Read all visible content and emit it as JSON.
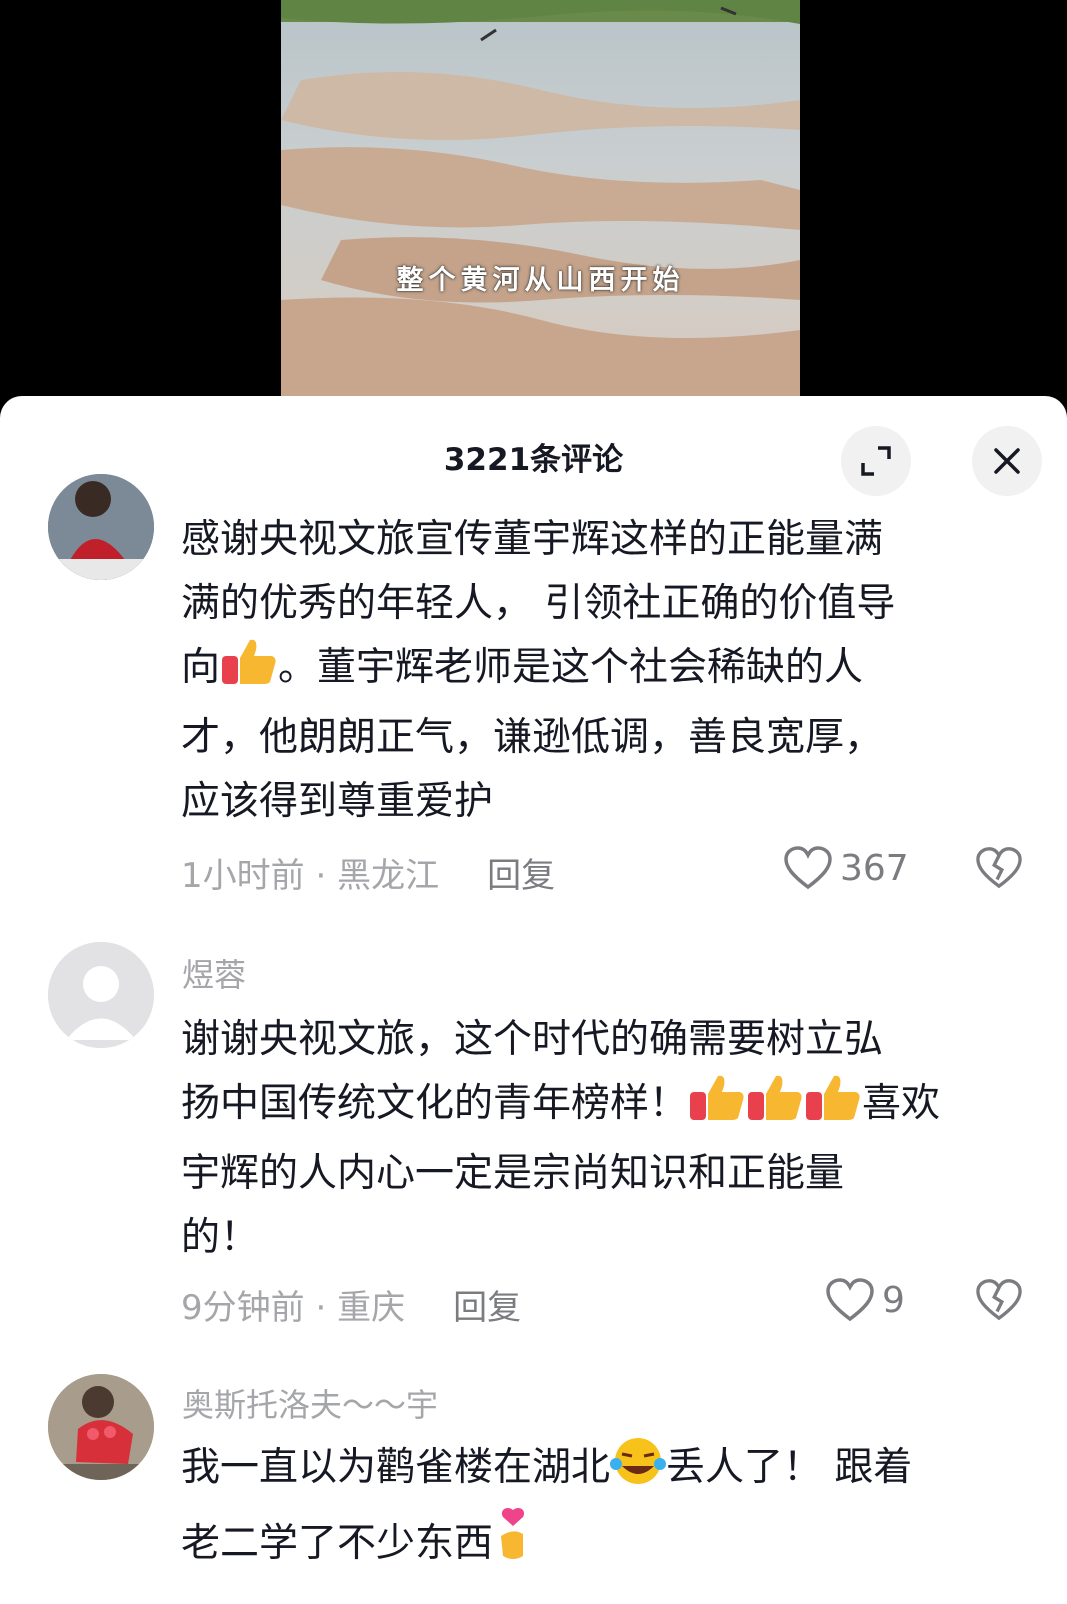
{
  "video": {
    "subtitle": "整个黄河从山西开始"
  },
  "sheet": {
    "title": "3221条评论",
    "expand_icon": "expand-icon",
    "close_icon": "close-icon"
  },
  "comments": [
    {
      "username": "",
      "lines": [
        "感谢央视文旅宣传董宇辉这样的正能量满",
        "满的优秀的年轻人， 引领社正确的价值导",
        "向",
        "。董宇辉老师是这个社会稀缺的人",
        "才，他朗朗正气，谦逊低调，善良宽厚，",
        "应该得到尊重爱护"
      ],
      "time": "1小时前",
      "location": "黑龙江",
      "reply": "回复",
      "likes": "367"
    },
    {
      "username": "煜蓉",
      "lines": [
        "谢谢央视文旅，这个时代的确需要树立弘",
        "扬中国传统文化的青年榜样！",
        "喜欢",
        "宇辉的人内心一定是宗尚知识和正能量",
        "的！"
      ],
      "time": "9分钟前",
      "location": "重庆",
      "reply": "回复",
      "likes": "9"
    },
    {
      "username": "奥斯托洛夫～～宇",
      "lines": [
        "我一直以为鹳雀楼在湖北",
        "丢人了！ 跟着",
        "老二学了不少东西"
      ]
    }
  ],
  "colors": {
    "text_primary": "#161823",
    "text_secondary": "#a5a6aa",
    "button_bg": "#f1f1f2"
  }
}
